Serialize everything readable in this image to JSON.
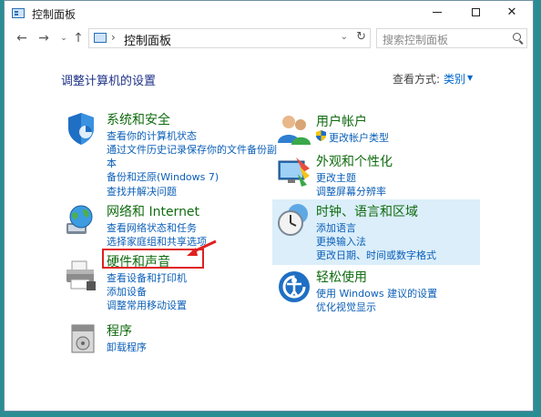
{
  "window": {
    "title": "控制面板"
  },
  "address": {
    "crumb": "控制面板",
    "search_placeholder": "搜索控制面板"
  },
  "content": {
    "page_title": "调整计算机的设置",
    "view_by_label": "查看方式:",
    "view_by_value": "类别"
  },
  "categories": {
    "system": {
      "title": "系统和安全",
      "links": [
        "查看你的计算机状态",
        "通过文件历史记录保存你的文件备份副",
        "本",
        "备份和还原(Windows 7)",
        "查找并解决问题"
      ]
    },
    "network": {
      "title": "网络和 Internet",
      "links": [
        "查看网络状态和任务",
        "选择家庭组和共享选项"
      ]
    },
    "hardware": {
      "title": "硬件和声音",
      "links": [
        "查看设备和打印机",
        "添加设备",
        "调整常用移动设置"
      ]
    },
    "programs": {
      "title": "程序",
      "links": [
        "卸载程序"
      ]
    },
    "accounts": {
      "title": "用户帐户",
      "links": [
        "更改帐户类型"
      ]
    },
    "appearance": {
      "title": "外观和个性化",
      "links": [
        "更改主题",
        "调整屏幕分辨率"
      ]
    },
    "clock": {
      "title": "时钟、语言和区域",
      "links": [
        "添加语言",
        "更换输入法",
        "更改日期、时间或数字格式"
      ]
    },
    "ease": {
      "title": "轻松使用",
      "links": [
        "使用 Windows 建议的设置",
        "优化视觉显示"
      ]
    }
  }
}
